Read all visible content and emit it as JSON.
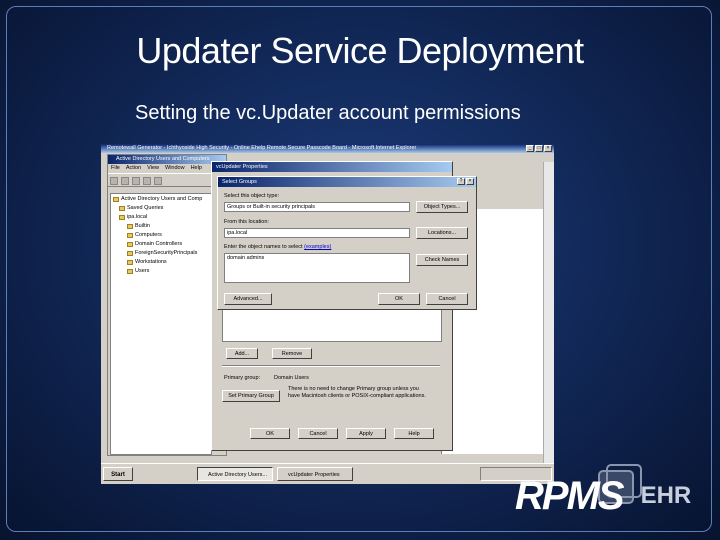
{
  "slide": {
    "title": "Updater Service Deployment",
    "subtitle": "Setting the vc.Updater account permissions"
  },
  "ie_window": {
    "title": "Remotewall Generator - Ichthyoside High Security - Online Ehelp Remote Secure Passcode Board - Microsoft Internet Explorer"
  },
  "aduc": {
    "title": "Active Directory Users and Computers",
    "menu": [
      "File",
      "Action",
      "View",
      "Window",
      "Help"
    ],
    "tree": [
      {
        "label": "Active Directory Users and Comp",
        "indent": 0
      },
      {
        "label": "Saved Queries",
        "indent": 1
      },
      {
        "label": "ipa.local",
        "indent": 1
      },
      {
        "label": "Builtin",
        "indent": 2
      },
      {
        "label": "Computers",
        "indent": 2
      },
      {
        "label": "Domain Controllers",
        "indent": 2
      },
      {
        "label": "ForeignSecurityPrincipals",
        "indent": 2
      },
      {
        "label": "Workstations",
        "indent": 2
      },
      {
        "label": "Users",
        "indent": 2
      }
    ]
  },
  "properties": {
    "title": "vcUpdater Properties",
    "add_label": "Add...",
    "remove_label": "Remove",
    "primary_group_label": "Primary group:",
    "primary_group_value": "Domain Users",
    "set_primary_label": "Set Primary Group",
    "note": "There is no need to change Primary group unless you have Macintosh clients or POSIX-compliant applications.",
    "ok_label": "OK",
    "cancel_label": "Cancel",
    "apply_label": "Apply",
    "help_label": "Help"
  },
  "select_groups": {
    "title": "Select Groups",
    "object_types_label": "Select this object type:",
    "object_types_value": "Groups or Built-in security principals",
    "object_types_button": "Object Types...",
    "location_label": "From this location:",
    "location_value": "ipa.local",
    "location_button": "Locations...",
    "names_label": "Enter the object names to select",
    "examples_link": "(examples)",
    "names_value": "domain admins",
    "check_names_button": "Check Names",
    "advanced_button": "Advanced...",
    "ok_button": "OK",
    "cancel_button": "Cancel"
  },
  "taskbar": {
    "start_label": "Start",
    "tasks": [
      "Active Directory Users...",
      "vcUpdater Properties"
    ]
  },
  "logo": {
    "brand": "RPMS",
    "suffix": "EHR"
  }
}
